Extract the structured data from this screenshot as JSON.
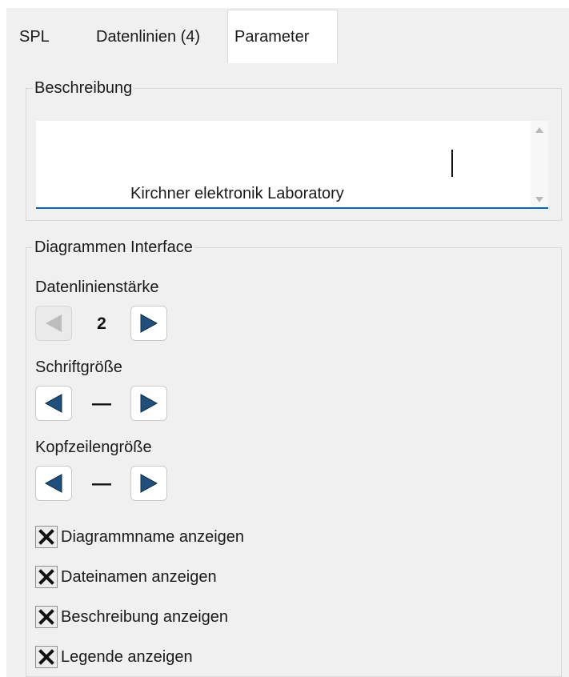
{
  "tabs": [
    {
      "label": "SPL",
      "active": false
    },
    {
      "label": "Datenlinien (4)",
      "active": false
    },
    {
      "label": "Parameter",
      "active": true
    }
  ],
  "description_group": {
    "title": "Beschreibung",
    "text": "Kirchner elektronik Laboratory"
  },
  "interface_group": {
    "title": "Diagrammen Interface",
    "line_width": {
      "label": "Datenlinienstärke",
      "value": "2"
    },
    "font_size": {
      "label": "Schriftgröße",
      "value": "—"
    },
    "header_size": {
      "label": "Kopfzeilengröße",
      "value": "—"
    },
    "checkboxes": [
      {
        "label": "Diagrammname anzeigen",
        "checked": true
      },
      {
        "label": "Dateinamen anzeigen",
        "checked": true
      },
      {
        "label": "Beschreibung anzeigen",
        "checked": true
      },
      {
        "label": "Legende anzeigen",
        "checked": true
      }
    ]
  },
  "colors": {
    "arrow_active": "#1f4f7a",
    "arrow_disabled": "#bdbdbd",
    "accent": "#0067c0"
  },
  "icons": {
    "stepper_left": "triangle-left-icon",
    "stepper_right": "triangle-right-icon",
    "checkbox_mark": "x-mark-icon"
  }
}
